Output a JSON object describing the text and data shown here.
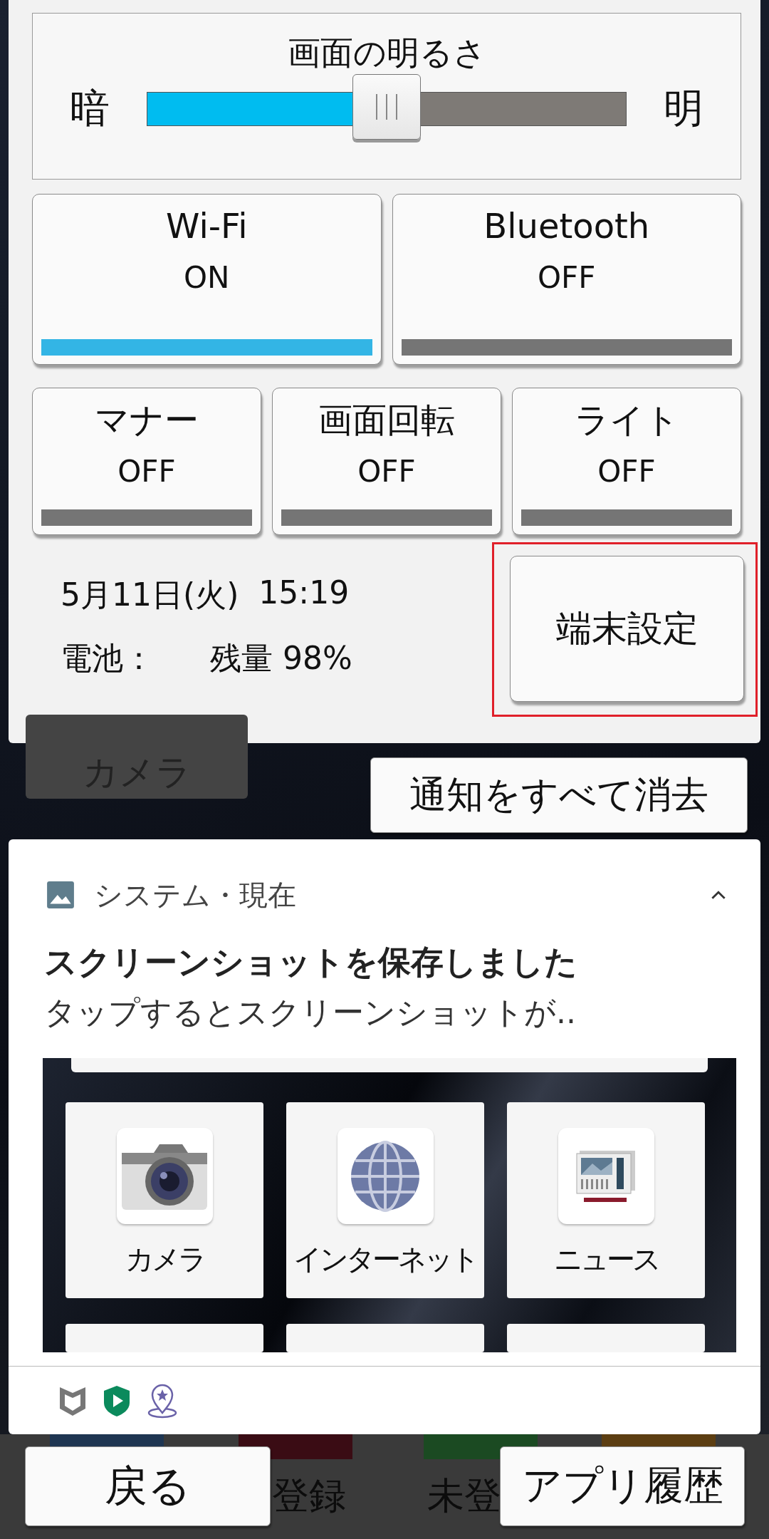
{
  "brightness": {
    "title": "画面の明るさ",
    "low_label": "暗",
    "high_label": "明",
    "level": 0.5
  },
  "toggles": [
    {
      "label": "Wi-Fi",
      "status": "ON",
      "on": true
    },
    {
      "label": "Bluetooth",
      "status": "OFF",
      "on": false
    },
    {
      "label": "マナー",
      "status": "OFF",
      "on": false
    },
    {
      "label": "画面回転",
      "status": "OFF",
      "on": false
    },
    {
      "label": "ライト",
      "status": "OFF",
      "on": false
    }
  ],
  "info": {
    "date": "5月11日(火)",
    "time": "15:19",
    "battery_label": "電池：",
    "battery_value": "残量 98%"
  },
  "settings_button": {
    "label": "端末設定",
    "highlighted": true
  },
  "home_tiles": [
    {
      "label": "カメラ"
    }
  ],
  "clear_button": "通知をすべて消去",
  "notification": {
    "source": "システム・現在",
    "expanded": true,
    "title": "スクリーンショットを保存しました",
    "text": "タップするとスクリーンショットが..",
    "preview_apps": [
      {
        "label": "カメラ",
        "kind": "camera"
      },
      {
        "label": "インターネット",
        "kind": "globe"
      },
      {
        "label": "ニュース",
        "kind": "news"
      }
    ]
  },
  "status_icons": [
    {
      "kind": "shield"
    },
    {
      "kind": "play"
    },
    {
      "kind": "pin"
    }
  ],
  "nav": {
    "back": "戻る",
    "recent": "アプリ履歴",
    "behind_labels": [
      "登録",
      "未登"
    ]
  }
}
